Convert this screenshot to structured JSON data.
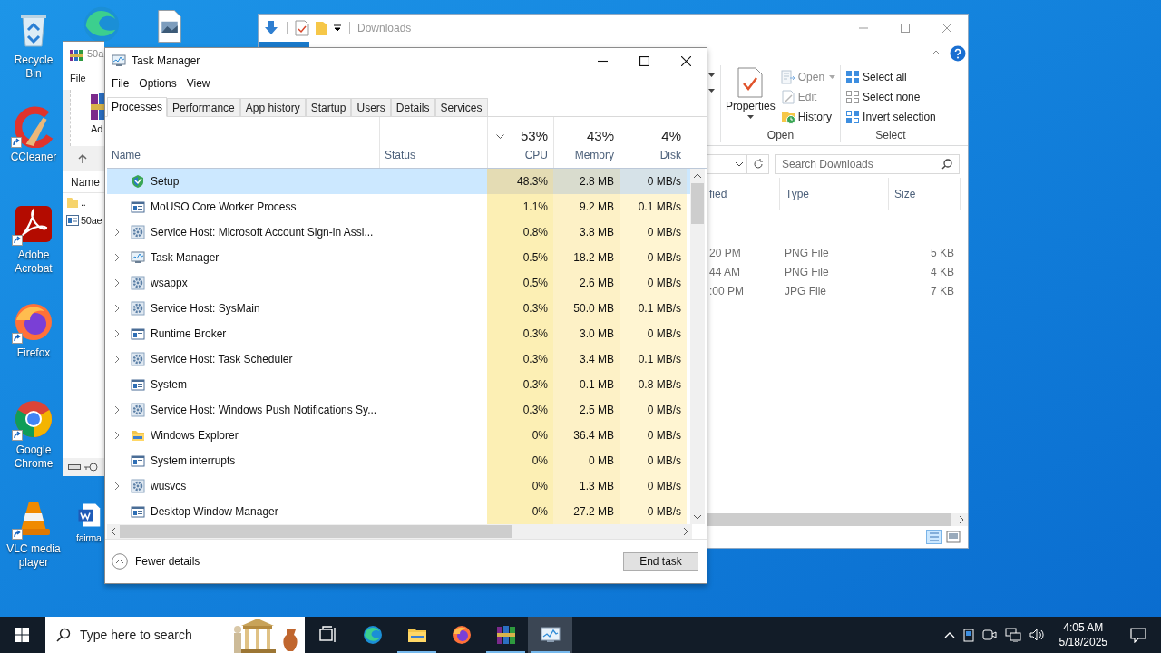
{
  "desktop_icons": [
    {
      "kind": "recycle-bin",
      "label": "Recycle Bin",
      "shortcut": false
    },
    {
      "kind": "edge",
      "shortcut": false
    },
    {
      "kind": "image-file",
      "shortcut": false
    },
    {
      "kind": "ccleaner",
      "label": "CCleaner",
      "shortcut": true
    },
    {
      "kind": "acrobat",
      "label": "Adobe Acrobat",
      "shortcut": true
    },
    {
      "kind": "firefox",
      "label": "Firefox",
      "shortcut": true
    },
    {
      "kind": "chrome",
      "label": "Google Chrome",
      "shortcut": true
    },
    {
      "kind": "vlc",
      "label": "VLC media player",
      "shortcut": true
    },
    {
      "kind": "word-doc",
      "label": "fairma",
      "shortcut": false
    }
  ],
  "explorer": {
    "title": "Downloads",
    "ribbon_groups": [
      {
        "label": "Open",
        "big_item": "Properties",
        "items": [
          {
            "label": "Open",
            "kind": "open",
            "disabled": true,
            "dropdown": true
          },
          {
            "label": "Edit",
            "kind": "edit",
            "disabled": true,
            "dropdown": false
          },
          {
            "label": "History",
            "kind": "history",
            "disabled": false,
            "dropdown": false
          }
        ]
      },
      {
        "label": "Select",
        "items": [
          {
            "label": "Select all",
            "kind": "select-all",
            "disabled": false,
            "dropdown": false
          },
          {
            "label": "Select none",
            "kind": "select-none",
            "disabled": false,
            "dropdown": false
          },
          {
            "label": "Invert selection",
            "kind": "invert",
            "disabled": false,
            "dropdown": false
          }
        ]
      }
    ],
    "search": {
      "placeholder": "Search Downloads"
    },
    "columns": [
      "fied",
      "Type",
      "Size"
    ],
    "rows": [
      {
        "modified": "20 PM",
        "type": "PNG File",
        "size": "5 KB"
      },
      {
        "modified": "44 AM",
        "type": "PNG File",
        "size": "4 KB"
      },
      {
        "modified": ":00 PM",
        "type": "JPG File",
        "size": "7 KB"
      }
    ]
  },
  "winrar": {
    "title": "50a",
    "menu": [
      "File"
    ],
    "toolbar": [
      "Ad"
    ],
    "column": "Name",
    "rows": [
      {
        "name": "..",
        "kind": "folder"
      },
      {
        "name": "50ae",
        "kind": "file"
      }
    ]
  },
  "task_manager": {
    "title": "Task Manager",
    "menu": [
      "File",
      "Options",
      "View"
    ],
    "tabs": [
      {
        "label": "Processes",
        "selected": true
      },
      {
        "label": "Performance",
        "selected": false
      },
      {
        "label": "App history",
        "selected": false
      },
      {
        "label": "Startup",
        "selected": false
      },
      {
        "label": "Users",
        "selected": false
      },
      {
        "label": "Details",
        "selected": false
      },
      {
        "label": "Services",
        "selected": false
      }
    ],
    "columns": [
      {
        "label": "Name"
      },
      {
        "label": "Status"
      },
      {
        "label": "CPU",
        "total": "53%",
        "sorted": true
      },
      {
        "label": "Memory",
        "total": "43%",
        "sorted": false
      },
      {
        "label": "Disk",
        "total": "4%",
        "sorted": false
      }
    ],
    "rows": [
      {
        "name": "Setup",
        "kind": "setup",
        "expandable": false,
        "selected": true,
        "cpu": "48.3%",
        "memory": "2.8 MB",
        "disk": "0 MB/s"
      },
      {
        "name": "MoUSO Core Worker Process",
        "kind": "window",
        "expandable": false,
        "selected": false,
        "cpu": "1.1%",
        "memory": "9.2 MB",
        "disk": "0.1 MB/s"
      },
      {
        "name": "Service Host: Microsoft Account Sign-in Assi...",
        "kind": "gear",
        "expandable": true,
        "selected": false,
        "cpu": "0.8%",
        "memory": "3.8 MB",
        "disk": "0 MB/s"
      },
      {
        "name": "Task Manager",
        "kind": "taskmgr",
        "expandable": true,
        "selected": false,
        "cpu": "0.5%",
        "memory": "18.2 MB",
        "disk": "0 MB/s"
      },
      {
        "name": "wsappx",
        "kind": "gear",
        "expandable": true,
        "selected": false,
        "cpu": "0.5%",
        "memory": "2.6 MB",
        "disk": "0 MB/s"
      },
      {
        "name": "Service Host: SysMain",
        "kind": "gear",
        "expandable": true,
        "selected": false,
        "cpu": "0.3%",
        "memory": "50.0 MB",
        "disk": "0.1 MB/s"
      },
      {
        "name": "Runtime Broker",
        "kind": "window",
        "expandable": true,
        "selected": false,
        "cpu": "0.3%",
        "memory": "3.0 MB",
        "disk": "0 MB/s"
      },
      {
        "name": "Service Host: Task Scheduler",
        "kind": "gear",
        "expandable": true,
        "selected": false,
        "cpu": "0.3%",
        "memory": "3.4 MB",
        "disk": "0.1 MB/s"
      },
      {
        "name": "System",
        "kind": "window",
        "expandable": false,
        "selected": false,
        "cpu": "0.3%",
        "memory": "0.1 MB",
        "disk": "0.8 MB/s"
      },
      {
        "name": "Service Host: Windows Push Notifications Sy...",
        "kind": "gear",
        "expandable": true,
        "selected": false,
        "cpu": "0.3%",
        "memory": "2.5 MB",
        "disk": "0 MB/s"
      },
      {
        "name": "Windows Explorer",
        "kind": "folder",
        "expandable": true,
        "selected": false,
        "cpu": "0%",
        "memory": "36.4 MB",
        "disk": "0 MB/s"
      },
      {
        "name": "System interrupts",
        "kind": "window",
        "expandable": false,
        "selected": false,
        "cpu": "0%",
        "memory": "0 MB",
        "disk": "0 MB/s"
      },
      {
        "name": "wusvcs",
        "kind": "gear",
        "expandable": true,
        "selected": false,
        "cpu": "0%",
        "memory": "1.3 MB",
        "disk": "0 MB/s"
      },
      {
        "name": "Desktop Window Manager",
        "kind": "window",
        "expandable": false,
        "selected": false,
        "cpu": "0%",
        "memory": "27.2 MB",
        "disk": "0 MB/s"
      }
    ],
    "fewer_details": "Fewer details",
    "end_task": "End task"
  },
  "taskbar": {
    "search": {
      "placeholder": "Type here to search"
    },
    "apps": [
      {
        "kind": "taskview",
        "open": false,
        "selected": false
      },
      {
        "kind": "edge",
        "open": false,
        "selected": false
      },
      {
        "kind": "explorer",
        "open": true,
        "selected": false
      },
      {
        "kind": "firefox",
        "open": false,
        "selected": false
      },
      {
        "kind": "winrar",
        "open": true,
        "selected": false
      },
      {
        "kind": "taskmgr",
        "open": true,
        "selected": true
      }
    ],
    "time": "4:05 AM",
    "date": "5/18/2025"
  }
}
